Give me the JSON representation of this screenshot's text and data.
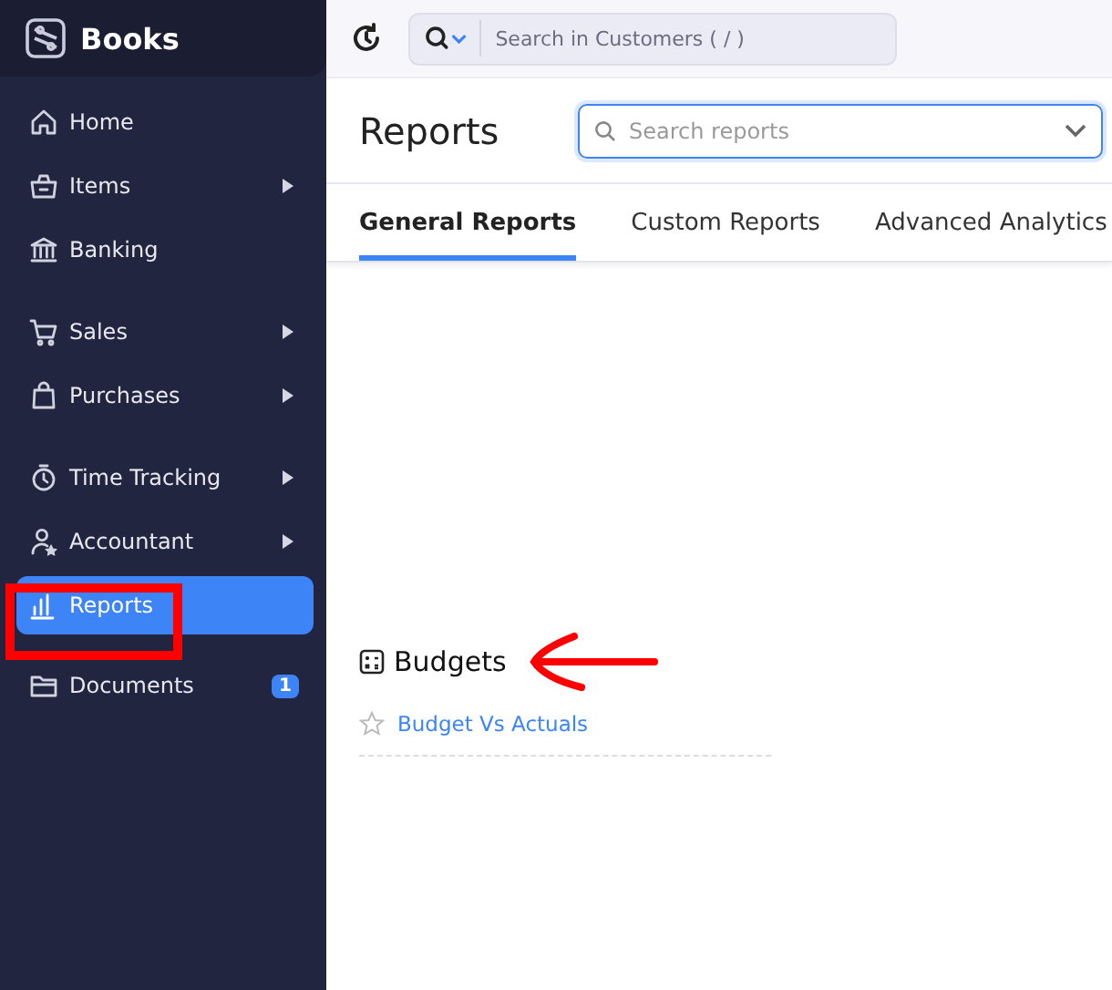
{
  "sidebar": {
    "brand": "Books",
    "sections": [
      [
        {
          "label": "Home",
          "has_submenu": false,
          "selected": false
        },
        {
          "label": "Items",
          "has_submenu": true,
          "selected": false
        },
        {
          "label": "Banking",
          "has_submenu": false,
          "selected": false
        }
      ],
      [
        {
          "label": "Sales",
          "has_submenu": true,
          "selected": false
        },
        {
          "label": "Purchases",
          "has_submenu": true,
          "selected": false
        }
      ],
      [
        {
          "label": "Time Tracking",
          "has_submenu": true,
          "selected": false
        },
        {
          "label": "Accountant",
          "has_submenu": true,
          "selected": false
        },
        {
          "label": "Reports",
          "has_submenu": false,
          "selected": true
        }
      ],
      [
        {
          "label": "Documents",
          "has_submenu": false,
          "selected": false,
          "badge": "1"
        }
      ]
    ]
  },
  "topbar": {
    "search": {
      "placeholder": "Search in Customers ( / )"
    }
  },
  "page": {
    "title": "Reports",
    "search": {
      "placeholder": "Search reports"
    },
    "tabs": [
      {
        "label": "General Reports",
        "selected": true
      },
      {
        "label": "Custom Reports",
        "selected": false
      },
      {
        "label": "Advanced Analytics",
        "selected": false
      }
    ],
    "section": {
      "title": "Budgets",
      "reports": [
        {
          "label": "Budget Vs Actuals",
          "favorite": false
        }
      ]
    }
  }
}
